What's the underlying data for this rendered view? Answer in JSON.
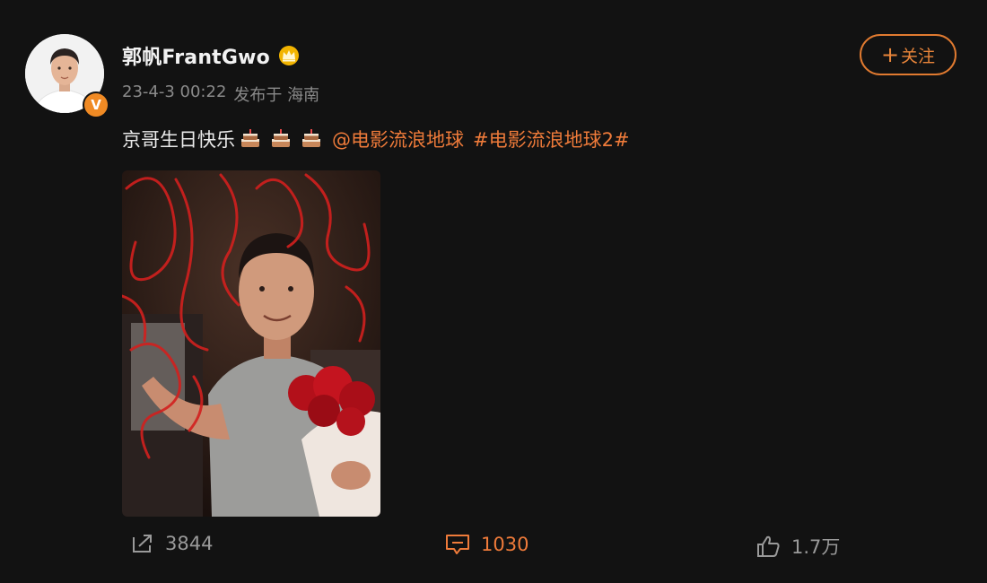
{
  "post": {
    "username": "郭帆FrantGwo",
    "verified_badge": "V",
    "date": "23-4-3 00:22",
    "location": "发布于 海南",
    "follow_label": "关注",
    "follow_plus": "+",
    "text_plain": "京哥生日快乐",
    "emojis": [
      "cake-icon",
      "cake-icon",
      "cake-icon"
    ],
    "mention": "@电影流浪地球",
    "hashtag": "#电影流浪地球2#"
  },
  "actions": {
    "repost_count": "3844",
    "comment_count": "1030",
    "like_count": "1.7万"
  },
  "colors": {
    "accent": "#ef7b3a",
    "background": "#121212",
    "meta_text": "#8a8a8a",
    "verified": "#f08a24",
    "crown": "#f2b400"
  },
  "icons": {
    "repost": "share-icon",
    "comment": "comment-icon",
    "like": "thumbs-up-icon",
    "member": "crown-icon"
  }
}
